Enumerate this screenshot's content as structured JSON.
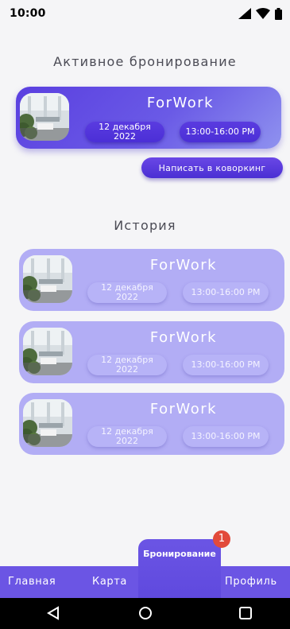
{
  "status_bar": {
    "time": "10:00"
  },
  "active": {
    "section_title": "Активное бронирование",
    "card": {
      "title": "ForWork",
      "date": "12 декабря 2022",
      "time": "13:00-16:00 PM"
    },
    "write_button": "Написать в коворкинг"
  },
  "history": {
    "section_title": "История",
    "items": [
      {
        "title": "ForWork",
        "date": "12 декабря 2022",
        "time": "13:00-16:00 PM"
      },
      {
        "title": "ForWork",
        "date": "12 декабря 2022",
        "time": "13:00-16:00 PM"
      },
      {
        "title": "ForWork",
        "date": "12 декабря 2022",
        "time": "13:00-16:00 PM"
      }
    ]
  },
  "bottom_nav": {
    "items": [
      "Главная",
      "Карта",
      "Бронирование",
      "Профиль"
    ],
    "active_index": 2,
    "badge_count": "1"
  },
  "colors": {
    "accent": "#6b55e4",
    "active_card_start": "#5a3fe0",
    "active_card_end": "#8f92ef",
    "history_card": "#b2adf5",
    "badge": "#e24a3b"
  },
  "icons": {
    "status": [
      "signal-icon",
      "wifi-icon",
      "battery-icon"
    ],
    "system_nav": [
      "back-icon",
      "home-icon",
      "recents-icon"
    ],
    "thumbnail": "coworking-photo"
  }
}
